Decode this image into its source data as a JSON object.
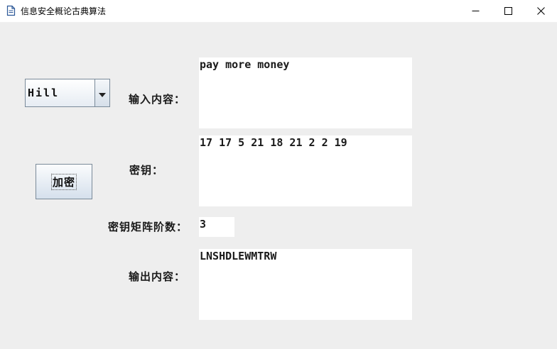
{
  "window": {
    "title": "信息安全概论古典算法"
  },
  "controls": {
    "algorithm_select": {
      "selected": "Hill"
    },
    "encrypt_button": {
      "label": "加密"
    }
  },
  "fields": {
    "input": {
      "label": "输入内容：",
      "value": "pay more money"
    },
    "key": {
      "label": "密钥：",
      "value": "17 17 5 21 18 21 2 2 19"
    },
    "matrix_order": {
      "label": "密钥矩阵阶数：",
      "value": "3"
    },
    "output": {
      "label": "输出内容：",
      "value": "LNSHDLEWMTRW"
    }
  },
  "icons": {
    "app": "document-icon",
    "minimize": "minimize-icon",
    "maximize": "maximize-icon",
    "close": "close-icon",
    "dropdown": "triangle-down-icon"
  }
}
